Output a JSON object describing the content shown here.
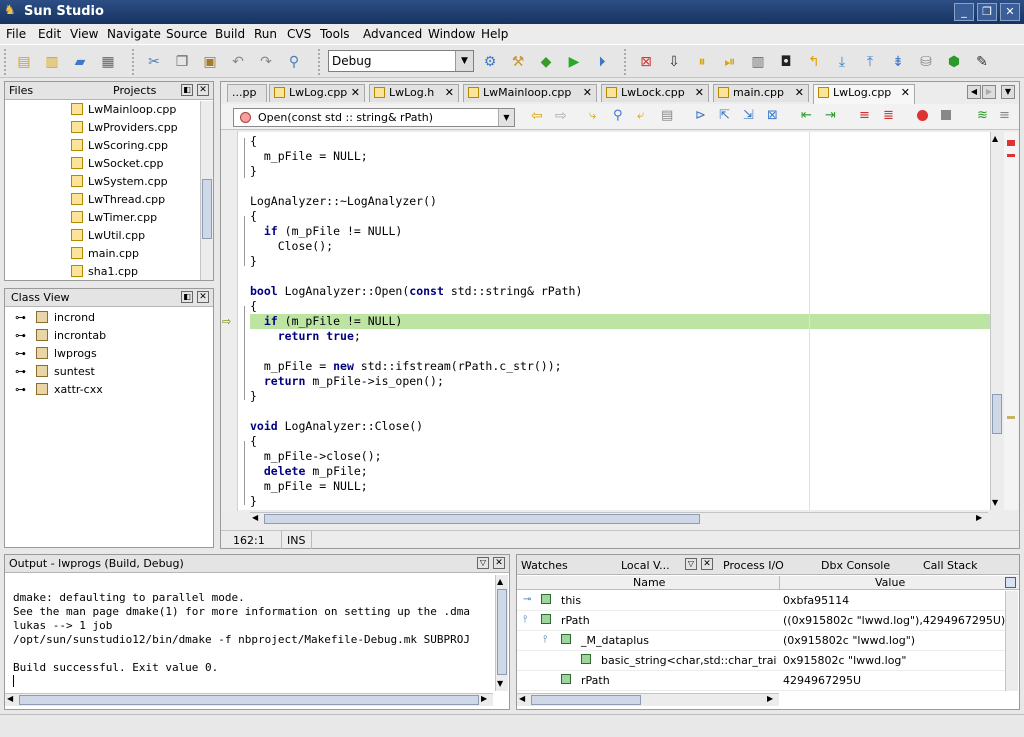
{
  "window": {
    "title": "Sun Studio",
    "min": "_",
    "max": "❐",
    "close": "✕"
  },
  "menu": [
    "File",
    "Edit",
    "View",
    "Navigate",
    "Source",
    "Build",
    "Run",
    "CVS",
    "Tools",
    "Advanced",
    "Window",
    "Help"
  ],
  "toolbar": {
    "config_value": "Debug"
  },
  "files_panel": {
    "tabs": [
      "Files",
      "Projects"
    ],
    "items": [
      "LwMainloop.cpp",
      "LwProviders.cpp",
      "LwScoring.cpp",
      "LwSocket.cpp",
      "LwSystem.cpp",
      "LwThread.cpp",
      "LwTimer.cpp",
      "LwUtil.cpp",
      "main.cpp",
      "sha1.cpp"
    ]
  },
  "class_view": {
    "title": "Class View",
    "items": [
      "incrond",
      "incrontab",
      "lwprogs",
      "suntest",
      "xattr-cxx"
    ]
  },
  "editor": {
    "tabs": [
      "...pp",
      "LwLog.cpp",
      "LwLog.h",
      "LwMainloop.cpp",
      "LwLock.cpp",
      "main.cpp",
      "LwLog.cpp"
    ],
    "function_selector": "Open(const std :: string& rPath)",
    "lines": [
      "{",
      "  m_pFile = NULL;",
      "}",
      "",
      "LogAnalyzer::~LogAnalyzer()",
      "{",
      "  if (m_pFile != NULL)",
      "    Close();",
      "}",
      "",
      "bool LogAnalyzer::Open(const std::string& rPath)",
      "{",
      "  if (m_pFile != NULL)",
      "    return true;",
      "",
      "  m_pFile = new std::ifstream(rPath.c_str());",
      "  return m_pFile->is_open();",
      "}",
      "",
      "void LogAnalyzer::Close()",
      "{",
      "  m_pFile->close();",
      "  delete m_pFile;",
      "  m_pFile = NULL;",
      "}"
    ],
    "cursor_pos": "162:1",
    "insert_mode": "INS"
  },
  "output": {
    "title": "Output - lwprogs (Build, Debug)",
    "lines": [
      "dmake: defaulting to parallel mode.",
      "See the man page dmake(1) for more information on setting up the .dma",
      "lukas --> 1 job",
      "/opt/sun/sunstudio12/bin/dmake -f nbproject/Makefile-Debug.mk SUBPROJ",
      "",
      "Build successful. Exit value 0."
    ]
  },
  "debug": {
    "tabs": [
      "Watches",
      "Local V...",
      "Process I/O",
      "Dbx Console",
      "Call Stack"
    ],
    "columns": [
      "Name",
      "Value"
    ],
    "rows": [
      {
        "name": "this",
        "value": "0xbfa95114"
      },
      {
        "name": "rPath",
        "value": "((0x915802c \"lwwd.log\"),4294967295U)"
      },
      {
        "name": "_M_dataplus",
        "value": "(0x915802c \"lwwd.log\")"
      },
      {
        "name": "basic_string<char,std::char_trait",
        "value": "0x915802c \"lwwd.log\""
      },
      {
        "name": "rPath",
        "value": "4294967295U"
      }
    ]
  }
}
